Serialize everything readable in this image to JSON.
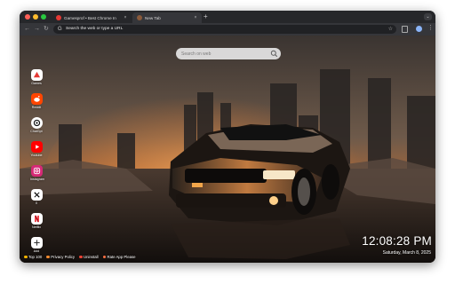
{
  "browser": {
    "tabs": [
      {
        "title": "Gamesprof • Best Chrome In",
        "close": "×"
      },
      {
        "title": "New Tab",
        "close": "×"
      }
    ],
    "new_tab_symbol": "+",
    "omnibox_placeholder": "Search the web or type a URL",
    "colors": {
      "active_tab": "#35363a",
      "toolbar": "#35363a",
      "omnibox": "#202124"
    }
  },
  "page": {
    "search_placeholder": "Search on web",
    "dock": [
      {
        "label": "Games",
        "icon": "games-icon",
        "bg": "#ffffff",
        "fg": "#e53935"
      },
      {
        "label": "Reddit",
        "icon": "reddit-icon",
        "bg": "#ff4500",
        "fg": "#ffffff"
      },
      {
        "label": "ChatGpt",
        "icon": "chatgpt-icon",
        "bg": "#ffffff",
        "fg": "#111111"
      },
      {
        "label": "Youtube",
        "icon": "youtube-icon",
        "bg": "#ff0000",
        "fg": "#ffffff"
      },
      {
        "label": "Instagram",
        "icon": "instagram-icon",
        "bg": "#d62976",
        "fg": "#ffffff"
      },
      {
        "label": "X",
        "icon": "x-icon",
        "bg": "#ffffff",
        "fg": "#000000"
      },
      {
        "label": "Netflix",
        "icon": "netflix-icon",
        "bg": "#ffffff",
        "fg": "#e50914"
      },
      {
        "label": "Add",
        "icon": "plus-icon",
        "bg": "#ffffff",
        "fg": "#333333"
      }
    ],
    "clock": {
      "time": "12:08:28 PM",
      "date": "Saturday, March 8, 2025"
    },
    "footer": [
      {
        "label": "Top 100",
        "color": "#f4b400"
      },
      {
        "label": "Privacy Policy",
        "color": "#f28b30"
      },
      {
        "label": "Uninstall",
        "color": "#ea4335"
      },
      {
        "label": "Rate App Please",
        "color": "#ff7043"
      }
    ]
  }
}
